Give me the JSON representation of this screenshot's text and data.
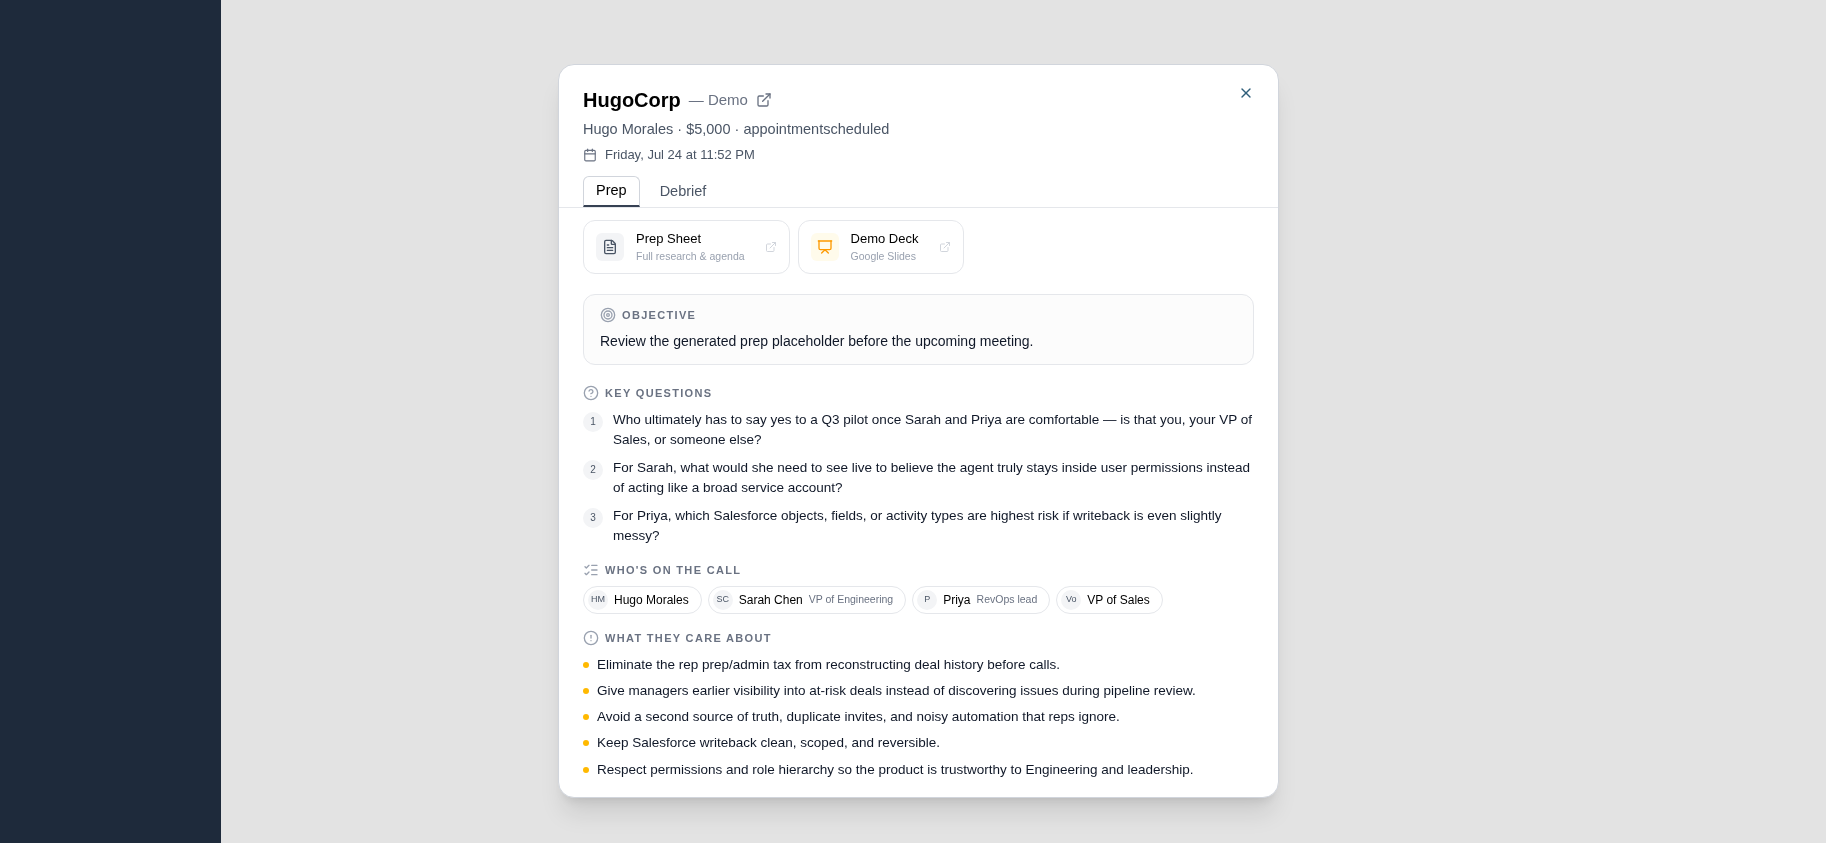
{
  "dialog": {
    "title": "HugoCorp",
    "title_suffix": "— Demo",
    "subtitle": "Hugo Morales · $5,000 · appointmentscheduled",
    "date": "Friday, Jul 24 at 11:52 PM",
    "tabs": [
      {
        "label": "Prep",
        "selected": true
      },
      {
        "label": "Debrief",
        "selected": false
      }
    ],
    "resources": [
      {
        "kind": "document",
        "title": "Prep Sheet",
        "subtitle": "Full research & agenda"
      },
      {
        "kind": "slides",
        "title": "Demo Deck",
        "subtitle": "Google Slides"
      }
    ],
    "objective": {
      "heading": "OBJECTIVE",
      "text": "Review the generated prep placeholder before the upcoming meeting."
    },
    "key_questions": {
      "heading": "KEY QUESTIONS",
      "items": [
        {
          "number": "1",
          "text": "Who ultimately has to say yes to a Q3 pilot once Sarah and Priya are comfortable — is that you, your VP of Sales, or someone else?"
        },
        {
          "number": "2",
          "text": "For Sarah, what would she need to see live to believe the agent truly stays inside user permissions instead of acting like a broad service account?"
        },
        {
          "number": "3",
          "text": "For Priya, which Salesforce objects, fields, or activity types are highest risk if writeback is even slightly messy?"
        }
      ]
    },
    "attendees": {
      "heading": "WHO'S ON THE CALL",
      "people": [
        {
          "initials": "HM",
          "name": "Hugo Morales"
        },
        {
          "initials": "SC",
          "name": "Sarah Chen",
          "role": "VP of Engineering"
        },
        {
          "initials": "P",
          "name": "Priya",
          "role": "RevOps lead"
        },
        {
          "initials": "Vo",
          "name": "VP of Sales"
        }
      ]
    },
    "cares": {
      "heading": "WHAT THEY CARE ABOUT",
      "items": [
        "Eliminate the rep prep/admin tax from reconstructing deal history before calls.",
        "Give managers earlier visibility into at-risk deals instead of discovering issues during pipeline review.",
        "Avoid a second source of truth, duplicate invites, and noisy automation that reps ignore.",
        "Keep Salesforce writeback clean, scoped, and reversible.",
        "Respect permissions and role hierarchy so the product is trustworthy to Engineering and leadership."
      ]
    }
  }
}
